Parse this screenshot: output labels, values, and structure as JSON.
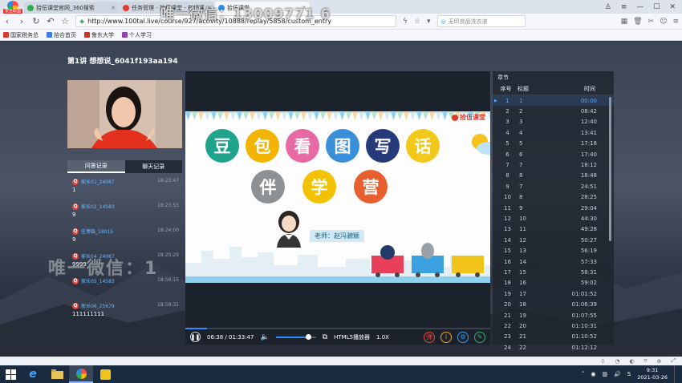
{
  "browser": {
    "badge": "安全联盟",
    "tabs": [
      {
        "title": "拾伍课堂官网_360搜索",
        "color": "#2fae4f",
        "active": false
      },
      {
        "title": "任务管理 - 拾伍课堂 - 在线课程",
        "color": "#e23a2f",
        "active": false
      },
      {
        "title": "拾伍课堂",
        "color": "#2b8ce6",
        "active": true
      }
    ],
    "url": "http://www.100tal.live/course/927/activity/10888/replay/5858/custom_entry",
    "search_placeholder": "无印良品洗衣液",
    "bookmarks": [
      {
        "label": "国家税务总",
        "color": "#d9382f"
      },
      {
        "label": "拾合首页",
        "color": "#3f7be6"
      },
      {
        "label": "鲁东大学",
        "color": "#c0392b"
      },
      {
        "label": "个人学习",
        "color": "#8e44ad"
      }
    ]
  },
  "watermark_top": "唯一微信：13009771 6",
  "watermark_mid": "唯一微信：1",
  "page": {
    "title": "第1讲 想想说_6041f193aa194"
  },
  "side_tabs": {
    "qa": "问答记录",
    "chat": "聊天记录"
  },
  "chat": [
    {
      "user": "家长01_24087",
      "time": "18:23:47",
      "msg": "1"
    },
    {
      "user": "家长02_14583",
      "time": "18:23:53",
      "msg": "9"
    },
    {
      "user": "任博淼_18015",
      "time": "18:24:00",
      "msg": "9"
    },
    {
      "user": "家长04_24087",
      "time": "18:25:29",
      "msg": "9999"
    },
    {
      "user": "家长05_14583",
      "time": "18:56:15",
      "msg": ""
    },
    {
      "user": "家长06_25679",
      "time": "18:58:31",
      "msg": "111111111"
    }
  ],
  "slide": {
    "brand": "拾伍课堂",
    "row1": [
      {
        "ch": "豆",
        "color": "#1fa38a"
      },
      {
        "ch": "包",
        "color": "#f2b400"
      },
      {
        "ch": "看",
        "color": "#e86aa2"
      },
      {
        "ch": "图",
        "color": "#3a8fd9"
      },
      {
        "ch": "写",
        "color": "#263a7a"
      },
      {
        "ch": "话",
        "color": "#f2c81a"
      }
    ],
    "row2": [
      {
        "ch": "伴",
        "color": "#8e9194"
      },
      {
        "ch": "学",
        "color": "#f2c200"
      },
      {
        "ch": "营",
        "color": "#e8602f"
      }
    ],
    "teacher_label": "老师：赵冯骢颖"
  },
  "player": {
    "current_time": "06:38",
    "total_time": "01:33:47",
    "progress": 0.071,
    "volume": 0.8,
    "mode": "HTML5播放器",
    "speed": "1.0X"
  },
  "chapters": {
    "title": "章节",
    "headers": {
      "idx": "序号",
      "name": "标题",
      "time": "时间"
    },
    "rows": [
      {
        "idx": "1",
        "name": "1",
        "time": "00:00",
        "active": true
      },
      {
        "idx": "2",
        "name": "2",
        "time": "08:42",
        "active": false
      },
      {
        "idx": "3",
        "name": "3",
        "time": "12:40",
        "active": false
      },
      {
        "idx": "4",
        "name": "4",
        "time": "13:41",
        "active": false
      },
      {
        "idx": "5",
        "name": "5",
        "time": "17:18",
        "active": false
      },
      {
        "idx": "6",
        "name": "6",
        "time": "17:40",
        "active": false
      },
      {
        "idx": "7",
        "name": "7",
        "time": "18:12",
        "active": false
      },
      {
        "idx": "8",
        "name": "8",
        "time": "18:48",
        "active": false
      },
      {
        "idx": "9",
        "name": "7",
        "time": "24:51",
        "active": false
      },
      {
        "idx": "10",
        "name": "8",
        "time": "28:25",
        "active": false
      },
      {
        "idx": "11",
        "name": "9",
        "time": "29:04",
        "active": false
      },
      {
        "idx": "12",
        "name": "10",
        "time": "44:30",
        "active": false
      },
      {
        "idx": "13",
        "name": "11",
        "time": "49:28",
        "active": false
      },
      {
        "idx": "14",
        "name": "12",
        "time": "50:27",
        "active": false
      },
      {
        "idx": "15",
        "name": "13",
        "time": "56:19",
        "active": false
      },
      {
        "idx": "16",
        "name": "14",
        "time": "57:33",
        "active": false
      },
      {
        "idx": "17",
        "name": "15",
        "time": "58:31",
        "active": false
      },
      {
        "idx": "18",
        "name": "16",
        "time": "59:02",
        "active": false
      },
      {
        "idx": "19",
        "name": "17",
        "time": "01:01:52",
        "active": false
      },
      {
        "idx": "20",
        "name": "18",
        "time": "01:06:39",
        "active": false
      },
      {
        "idx": "21",
        "name": "19",
        "time": "01:07:55",
        "active": false
      },
      {
        "idx": "22",
        "name": "20",
        "time": "01:10:31",
        "active": false
      },
      {
        "idx": "23",
        "name": "21",
        "time": "01:10:52",
        "active": false
      },
      {
        "idx": "24",
        "name": "22",
        "time": "01:12:12",
        "active": false
      }
    ]
  },
  "taskbar": {
    "time": "9:31",
    "date": "2021-03-26"
  }
}
